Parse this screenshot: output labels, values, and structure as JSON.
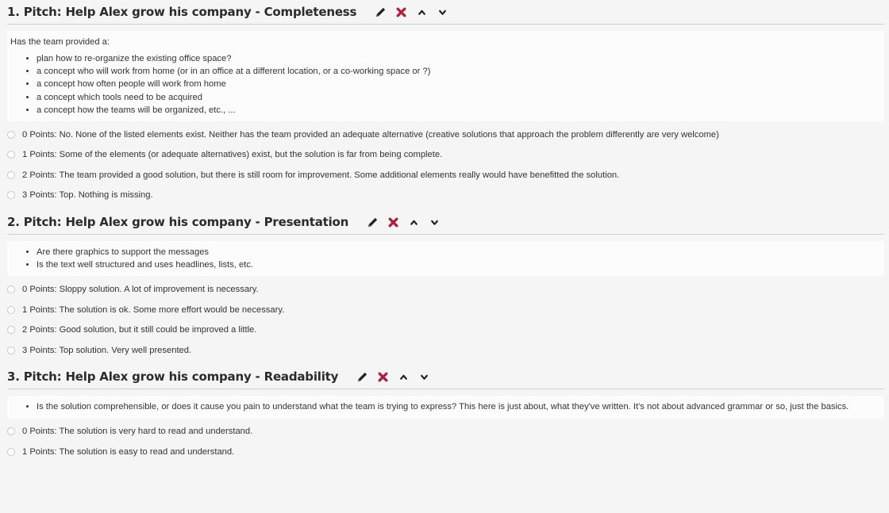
{
  "colors": {
    "delete": "#b0203a",
    "pencil": "#222222"
  },
  "icons": [
    "pencil-icon",
    "delete-x-icon",
    "chevron-up-icon",
    "chevron-down-icon"
  ],
  "sections": [
    {
      "title": "1. Pitch: Help Alex grow his company - Completeness",
      "intro": "Has the team provided a:",
      "bullets": [
        "plan how to re-organize the existing office space?",
        "a concept who will work from home (or in an office at a different location, or a co-working space or ?)",
        "a concept how often people will work from home",
        "a concept which tools need to be acquired",
        "a concept how the teams will be organized, etc., ..."
      ],
      "options": [
        "0 Points: No. None of the listed elements exist. Neither has the team provided an adequate alternative (creative solutions that approach the problem differently are very welcome)",
        "1 Points: Some of the elements (or adequate alternatives) exist, but the solution is far from being complete.",
        "2 Points: The team provided a good solution, but there is still room for improvement. Some additional elements really would have benefitted the solution.",
        "3 Points: Top. Nothing is missing."
      ]
    },
    {
      "title": "2. Pitch: Help Alex grow his company - Presentation",
      "intro": "",
      "bullets": [
        "Are there graphics to support the messages",
        "Is the text well structured and uses headlines, lists, etc."
      ],
      "options": [
        "0 Points: Sloppy solution. A lot of improvement is necessary.",
        "1 Points: The solution is ok. Some more effort would be necessary.",
        "2 Points: Good solution, but it still could be improved a little.",
        "3 Points: Top solution. Very well presented."
      ]
    },
    {
      "title": "3. Pitch: Help Alex grow his company - Readability",
      "intro": "",
      "bullets": [
        "Is the solution comprehensible, or does it cause you pain to understand what the team is trying to express? This here is just about, what they've written. It's not about advanced grammar or so, just the basics."
      ],
      "options": [
        "0 Points: The solution is very hard to read and understand.",
        "1 Points: The solution is easy to read and understand."
      ]
    }
  ]
}
